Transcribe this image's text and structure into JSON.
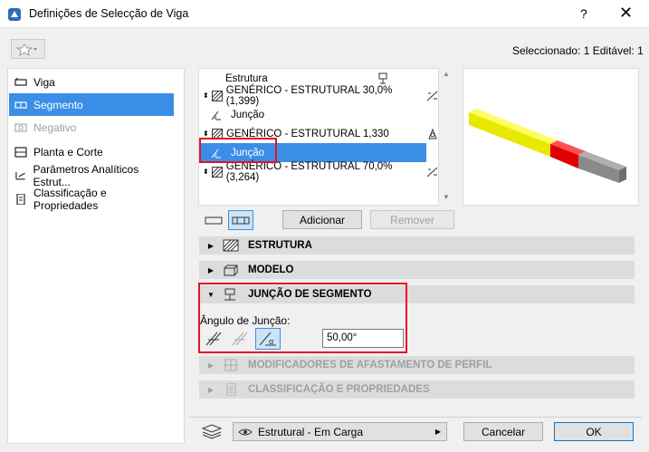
{
  "window": {
    "title": "Definições de Selecção de Viga",
    "help_label": "?",
    "close_label": "✕"
  },
  "selection_info": "Seleccionado: 1 Editável: 1",
  "sidebar": {
    "items": [
      {
        "label": "Viga"
      },
      {
        "label": "Segmento"
      },
      {
        "label": "Negativo"
      },
      {
        "label": "Planta e Corte"
      },
      {
        "label": "Parâmetros Analíticos Estrut..."
      },
      {
        "label": "Classificação e Propriedades"
      }
    ]
  },
  "structure_list": {
    "header": "Estrutura",
    "rows": [
      {
        "label": "GENÉRICO - ESTRUTURAL 30,0% (1,399)"
      },
      {
        "label": "Junção"
      },
      {
        "label": "GENÉRICO - ESTRUTURAL 1,330"
      },
      {
        "label": "Junção"
      },
      {
        "label": "GENÉRICO - ESTRUTURAL 70,0% (3,264)"
      }
    ]
  },
  "buttons": {
    "add": "Adicionar",
    "remove": "Remover",
    "cancel": "Cancelar",
    "ok": "OK"
  },
  "sections": {
    "structure": "ESTRUTURA",
    "model": "MODELO",
    "segment_join": "JUNÇÃO DE SEGMENTO",
    "profile_offset": "MODIFICADORES DE AFASTAMENTO DE PERFIL",
    "classification": "CLASSIFICAÇÃO E PROPRIEDADES"
  },
  "segment_join": {
    "angle_label": "Ângulo de Junção:",
    "angle_value": "50,00°"
  },
  "footer": {
    "layer_value": "Estrutural - Em Carga"
  },
  "colors": {
    "selection_blue": "#3a8ee6",
    "highlight_red": "#e81123",
    "beam_yellow": "#e8e800",
    "beam_red": "#e00000",
    "beam_gray": "#8a8a8a"
  }
}
